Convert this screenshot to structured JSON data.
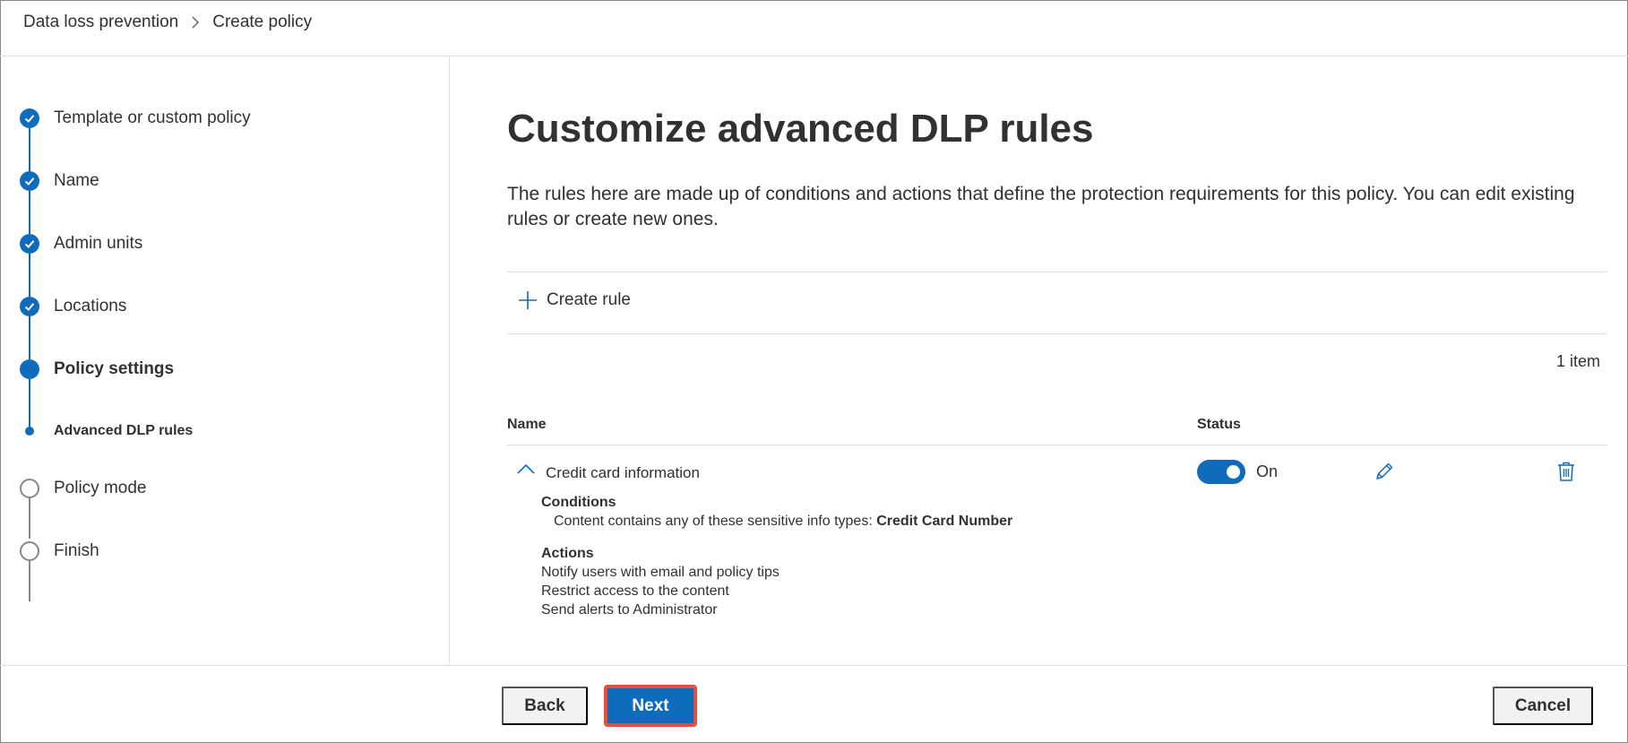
{
  "breadcrumb": {
    "items": [
      "Data loss prevention",
      "Create policy"
    ]
  },
  "nav": {
    "steps": [
      {
        "label": "Template or custom policy",
        "state": "done"
      },
      {
        "label": "Name",
        "state": "done"
      },
      {
        "label": "Admin units",
        "state": "done"
      },
      {
        "label": "Locations",
        "state": "done"
      },
      {
        "label": "Policy settings",
        "state": "current"
      },
      {
        "label": "Advanced DLP rules",
        "state": "current-sub"
      },
      {
        "label": "Policy mode",
        "state": "todo"
      },
      {
        "label": "Finish",
        "state": "todo"
      }
    ]
  },
  "main": {
    "title": "Customize advanced DLP rules",
    "description": "The rules here are made up of conditions and actions that define the protection requirements for this policy. You can edit existing rules or create new ones.",
    "create_rule_label": "Create rule",
    "item_count": "1 item",
    "columns": {
      "name": "Name",
      "status": "Status"
    },
    "rules": [
      {
        "name": "Credit card information",
        "status": "On",
        "enabled": true,
        "conditions_heading": "Conditions",
        "condition_text": "Content contains any of these sensitive info types: ",
        "condition_value": "Credit Card Number",
        "actions_heading": "Actions",
        "actions": [
          "Notify users with email and policy tips",
          "Restrict access to the content",
          "Send alerts to Administrator"
        ]
      }
    ]
  },
  "footer": {
    "back_label": "Back",
    "next_label": "Next",
    "cancel_label": "Cancel"
  },
  "colors": {
    "accent": "#0f6cbd",
    "highlight": "#e74c3c"
  }
}
